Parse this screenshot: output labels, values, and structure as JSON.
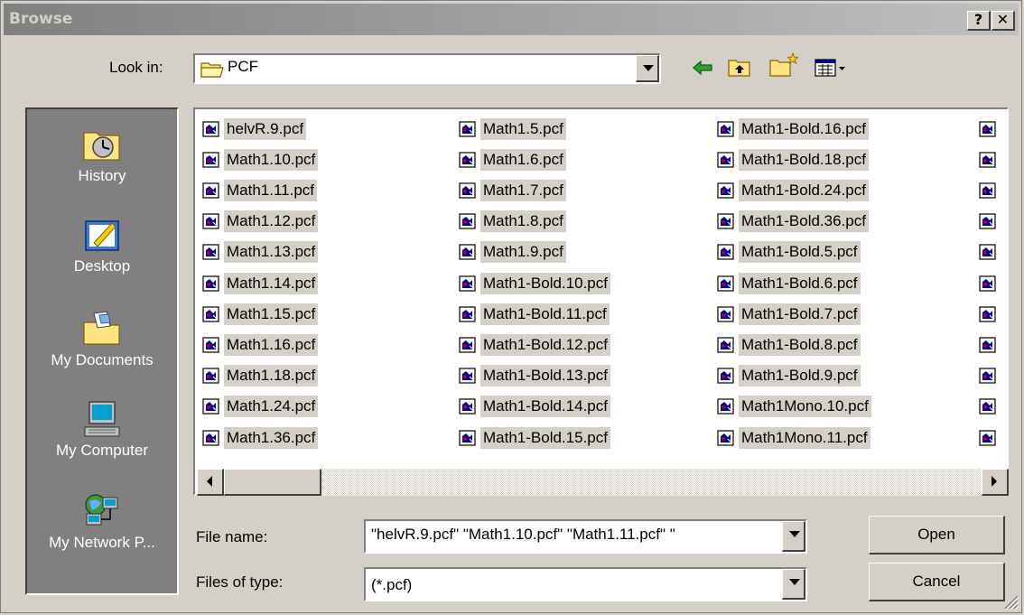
{
  "window": {
    "title": "Browse",
    "help_label": "?",
    "close_label": "✕"
  },
  "lookin": {
    "label": "Look in:",
    "value": "PCF"
  },
  "toolbar": {
    "icons": [
      "back-arrow-icon",
      "up-folder-icon",
      "new-folder-icon",
      "view-menu-icon"
    ]
  },
  "places": [
    {
      "label": "History",
      "icon": "history-icon"
    },
    {
      "label": "Desktop",
      "icon": "desktop-icon"
    },
    {
      "label": "My Documents",
      "icon": "my-documents-icon"
    },
    {
      "label": "My Computer",
      "icon": "my-computer-icon"
    },
    {
      "label": "My Network P...",
      "icon": "my-network-icon"
    }
  ],
  "files": {
    "col1": [
      "helvR.9.pcf",
      "Math1.10.pcf",
      "Math1.11.pcf",
      "Math1.12.pcf",
      "Math1.13.pcf",
      "Math1.14.pcf",
      "Math1.15.pcf",
      "Math1.16.pcf",
      "Math1.18.pcf",
      "Math1.24.pcf",
      "Math1.36.pcf"
    ],
    "col2": [
      "Math1.5.pcf",
      "Math1.6.pcf",
      "Math1.7.pcf",
      "Math1.8.pcf",
      "Math1.9.pcf",
      "Math1-Bold.10.pcf",
      "Math1-Bold.11.pcf",
      "Math1-Bold.12.pcf",
      "Math1-Bold.13.pcf",
      "Math1-Bold.14.pcf",
      "Math1-Bold.15.pcf"
    ],
    "col3": [
      "Math1-Bold.16.pcf",
      "Math1-Bold.18.pcf",
      "Math1-Bold.24.pcf",
      "Math1-Bold.36.pcf",
      "Math1-Bold.5.pcf",
      "Math1-Bold.6.pcf",
      "Math1-Bold.7.pcf",
      "Math1-Bold.8.pcf",
      "Math1-Bold.9.pcf",
      "Math1Mono.10.pcf",
      "Math1Mono.11.pcf"
    ]
  },
  "filename": {
    "label": "File name:",
    "value": "\"helvR.9.pcf\" \"Math1.10.pcf\" \"Math1.11.pcf\" \""
  },
  "filetype": {
    "label": "Files of type:",
    "value": "(*.pcf)"
  },
  "buttons": {
    "open": "Open",
    "cancel": "Cancel"
  }
}
